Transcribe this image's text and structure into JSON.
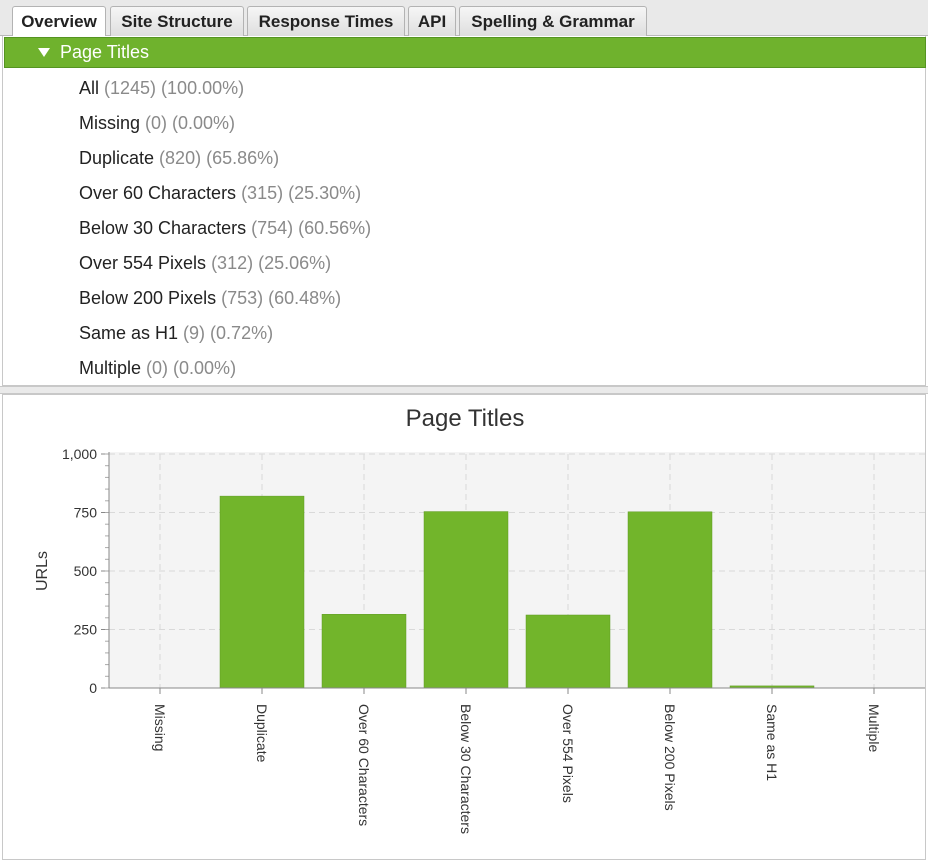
{
  "tabs": [
    {
      "label": "Overview",
      "active": true
    },
    {
      "label": "Site Structure",
      "active": false
    },
    {
      "label": "Response Times",
      "active": false
    },
    {
      "label": "API",
      "active": false
    },
    {
      "label": "Spelling & Grammar",
      "active": false
    }
  ],
  "tree": {
    "header": "Page Titles",
    "expand_icon": "triangle-down-icon",
    "items": [
      {
        "label": "All",
        "count": "(1245)",
        "percent": "(100.00%)"
      },
      {
        "label": "Missing",
        "count": "(0)",
        "percent": "(0.00%)"
      },
      {
        "label": "Duplicate",
        "count": "(820)",
        "percent": "(65.86%)"
      },
      {
        "label": "Over 60 Characters",
        "count": "(315)",
        "percent": "(25.30%)"
      },
      {
        "label": "Below 30 Characters",
        "count": "(754)",
        "percent": "(60.56%)"
      },
      {
        "label": "Over 554 Pixels",
        "count": "(312)",
        "percent": "(25.06%)"
      },
      {
        "label": "Below 200 Pixels",
        "count": "(753)",
        "percent": "(60.48%)"
      },
      {
        "label": "Same as H1",
        "count": "(9)",
        "percent": "(0.72%)"
      },
      {
        "label": "Multiple",
        "count": "(0)",
        "percent": "(0.00%)"
      }
    ]
  },
  "colors": {
    "accent": "#6fb22d",
    "bar": "#72b52b",
    "plot_bg": "#f4f4f4",
    "grid": "#d9d9d9"
  },
  "chart_data": {
    "type": "bar",
    "title": "Page Titles",
    "xlabel": "",
    "ylabel": "URLs",
    "categories": [
      "Missing",
      "Duplicate",
      "Over 60 Characters",
      "Below 30 Characters",
      "Over 554 Pixels",
      "Below 200 Pixels",
      "Same as H1",
      "Multiple"
    ],
    "values": [
      0,
      820,
      315,
      754,
      312,
      753,
      9,
      0
    ],
    "ylim": [
      0,
      1000
    ],
    "yticks": [
      0,
      250,
      500,
      750,
      1000
    ],
    "ytick_labels": [
      "0",
      "250",
      "500",
      "750",
      "1,000"
    ],
    "grid": true,
    "legend": "none"
  }
}
